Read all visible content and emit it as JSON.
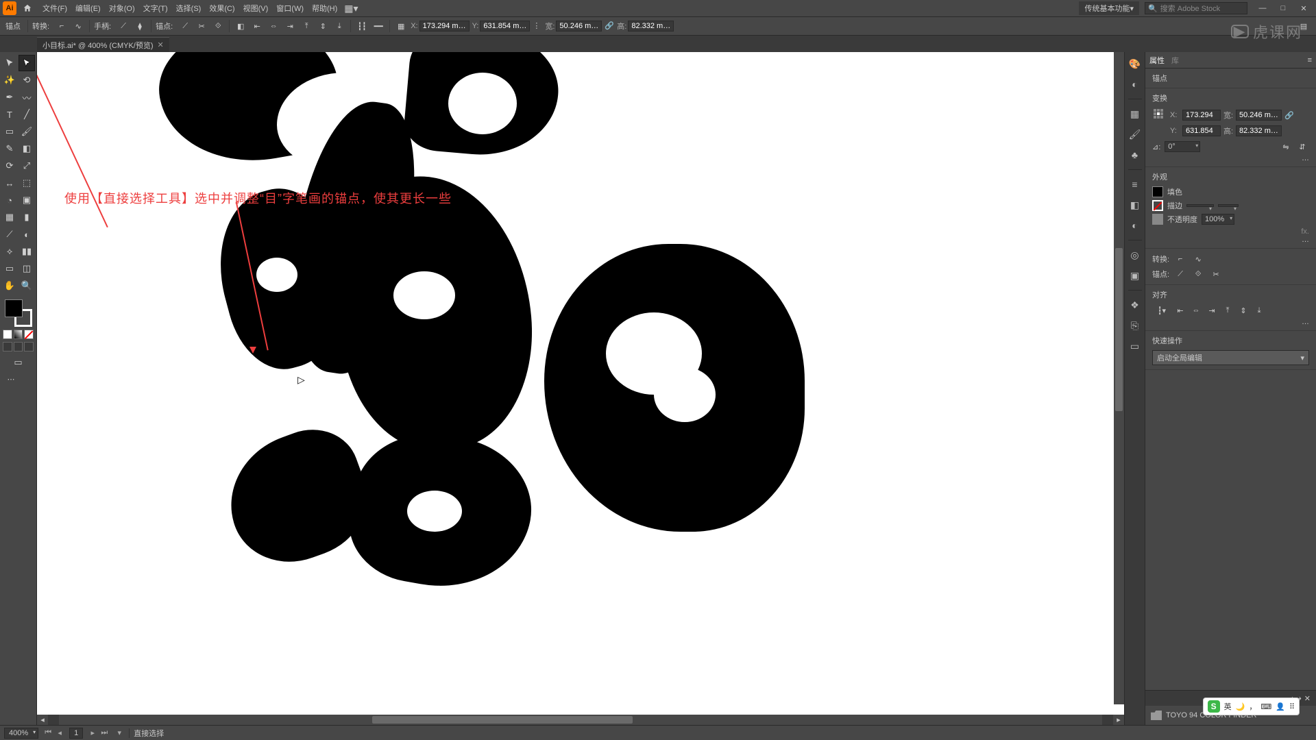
{
  "menubar": {
    "app_abbr": "Ai",
    "items": [
      "文件(F)",
      "编辑(E)",
      "对象(O)",
      "文字(T)",
      "选择(S)",
      "效果(C)",
      "视图(V)",
      "窗口(W)",
      "帮助(H)"
    ],
    "workspace": "传统基本功能",
    "search_placeholder": "搜索 Adobe Stock"
  },
  "controlbar": {
    "label_anchor": "锚点",
    "label_convert": "转换:",
    "label_handle": "手柄:",
    "label_anchors2": "锚点:",
    "x_label": "X:",
    "x_value": "173.294 m…",
    "y_label": "Y:",
    "y_value": "631.854 m…",
    "w_label": "宽:",
    "w_value": "50.246 m…",
    "h_label": "高:",
    "h_value": "82.332 m…"
  },
  "doc_tab": {
    "title": "小目标.ai* @ 400% (CMYK/预览)"
  },
  "artwork": {
    "annotation": "使用【直接选择工具】选中并调整“目”字笔画的锚点，使其更长一些"
  },
  "properties": {
    "tab_props": "属性",
    "tab_libs": "库",
    "sel_type": "锚点",
    "sec_transform": "变换",
    "x_label": "X:",
    "x_value": "173.294",
    "y_label": "Y:",
    "y_value": "631.854",
    "w_label": "宽:",
    "w_value": "50.246 m…",
    "h_label": "高:",
    "h_value": "82.332 m…",
    "rot_label": "⊿:",
    "rot_value": "0°",
    "more": "…",
    "sec_appearance": "外观",
    "fill_label": "填色",
    "stroke_label": "描边",
    "stroke_weight": "",
    "opacity_label": "不透明度",
    "opacity_value": "100%",
    "fx": "fx.",
    "convert_label": "转换:",
    "anchors_label": "锚点:",
    "sec_align": "对齐",
    "sec_quick": "快速操作",
    "quick_btn": "启动全局编辑"
  },
  "collapsed_panel": {
    "title": "TOYO 94 COLOR FINDER"
  },
  "status": {
    "zoom": "400%",
    "artboard": "1",
    "tool": "直接选择"
  },
  "watermark": "虎课网",
  "ime": {
    "lang": "英",
    "moon": "⌒"
  }
}
